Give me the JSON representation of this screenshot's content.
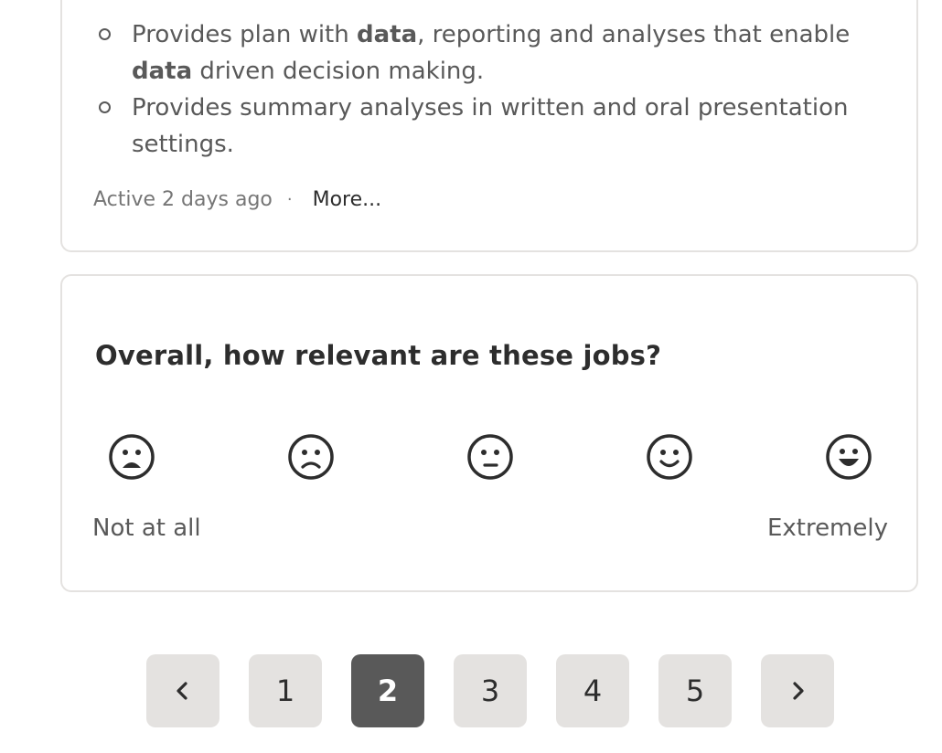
{
  "job_card": {
    "bullets": [
      {
        "parts": [
          {
            "text": "Provides plan with ",
            "bold": false
          },
          {
            "text": "data",
            "bold": true
          },
          {
            "text": ", reporting and analyses that enable ",
            "bold": false
          },
          {
            "text": "data",
            "bold": true
          },
          {
            "text": " driven decision making.",
            "bold": false
          }
        ]
      },
      {
        "parts": [
          {
            "text": "Provides summary analyses in written and oral presentation settings.",
            "bold": false
          }
        ]
      }
    ],
    "activity": "Active 2 days ago",
    "separator": "·",
    "more_label": "More..."
  },
  "survey": {
    "question": "Overall, how relevant are these jobs?",
    "faces": [
      {
        "icon": "very-unhappy-face-icon",
        "rating": 1
      },
      {
        "icon": "unhappy-face-icon",
        "rating": 2
      },
      {
        "icon": "neutral-face-icon",
        "rating": 3
      },
      {
        "icon": "happy-face-icon",
        "rating": 4
      },
      {
        "icon": "very-happy-face-icon",
        "rating": 5
      }
    ],
    "low_label": "Not at all",
    "high_label": "Extremely"
  },
  "pagination": {
    "prev_icon": "chevron-left-icon",
    "next_icon": "chevron-right-icon",
    "pages": [
      "1",
      "2",
      "3",
      "4",
      "5"
    ],
    "current": "2"
  },
  "colors": {
    "text_dark": "#2d2d2d",
    "text_body": "#595959",
    "border": "#e4e2e0",
    "page_bg": "#e4e2e0",
    "page_current_bg": "#595959"
  }
}
